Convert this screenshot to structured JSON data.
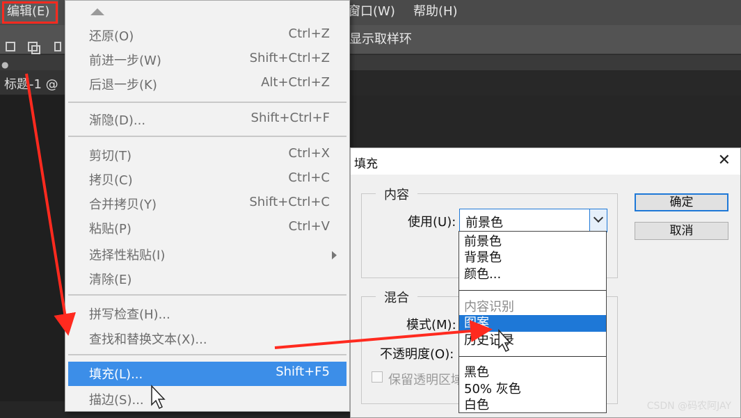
{
  "menubar": {
    "edit": "编辑(E)",
    "window": "窗口(W)",
    "help": "帮助(H)"
  },
  "options_bar": {
    "text": "显示取样环"
  },
  "document_tab": {
    "label": "标题-1 @"
  },
  "edit_menu": {
    "items": [
      {
        "label": "还原(O)",
        "shortcut": "Ctrl+Z"
      },
      {
        "label": "前进一步(W)",
        "shortcut": "Shift+Ctrl+Z"
      },
      {
        "label": "后退一步(K)",
        "shortcut": "Alt+Ctrl+Z"
      },
      {
        "label": "渐隐(D)...",
        "shortcut": "Shift+Ctrl+F"
      },
      {
        "label": "剪切(T)",
        "shortcut": "Ctrl+X"
      },
      {
        "label": "拷贝(C)",
        "shortcut": "Ctrl+C"
      },
      {
        "label": "合并拷贝(Y)",
        "shortcut": "Shift+Ctrl+C"
      },
      {
        "label": "粘贴(P)",
        "shortcut": "Ctrl+V"
      },
      {
        "label": "选择性粘贴(I)",
        "shortcut": ""
      },
      {
        "label": "清除(E)",
        "shortcut": ""
      },
      {
        "label": "拼写检查(H)...",
        "shortcut": ""
      },
      {
        "label": "查找和替换文本(X)...",
        "shortcut": ""
      },
      {
        "label": "填充(L)...",
        "shortcut": "Shift+F5"
      },
      {
        "label": "描边(S)...",
        "shortcut": ""
      }
    ],
    "active_item": "填充(L)..."
  },
  "fill_dialog": {
    "title": "填充",
    "content_group": "内容",
    "use_label": "使用(U):",
    "use_value": "前景色",
    "blend_group": "混合",
    "mode_label": "模式(M):",
    "opacity_label": "不透明度(O):",
    "preserve_label": "保留透明区域",
    "ok_button": "确定",
    "cancel_button": "取消",
    "dropdown_options": [
      {
        "label": "前景色",
        "enabled": true
      },
      {
        "label": "背景色",
        "enabled": true
      },
      {
        "label": "颜色...",
        "enabled": true
      },
      {
        "label": "内容识别",
        "enabled": false
      },
      {
        "label": "图案",
        "enabled": true
      },
      {
        "label": "历史记录",
        "enabled": true
      },
      {
        "label": "黑色",
        "enabled": true
      },
      {
        "label": "50% 灰色",
        "enabled": true
      },
      {
        "label": "白色",
        "enabled": true
      }
    ],
    "highlighted_option": "图案"
  },
  "watermark": "CSDN @码农阿JAY",
  "colors": {
    "annotation_red": "#ff2a1f",
    "selection_blue": "#3c8ee8"
  }
}
